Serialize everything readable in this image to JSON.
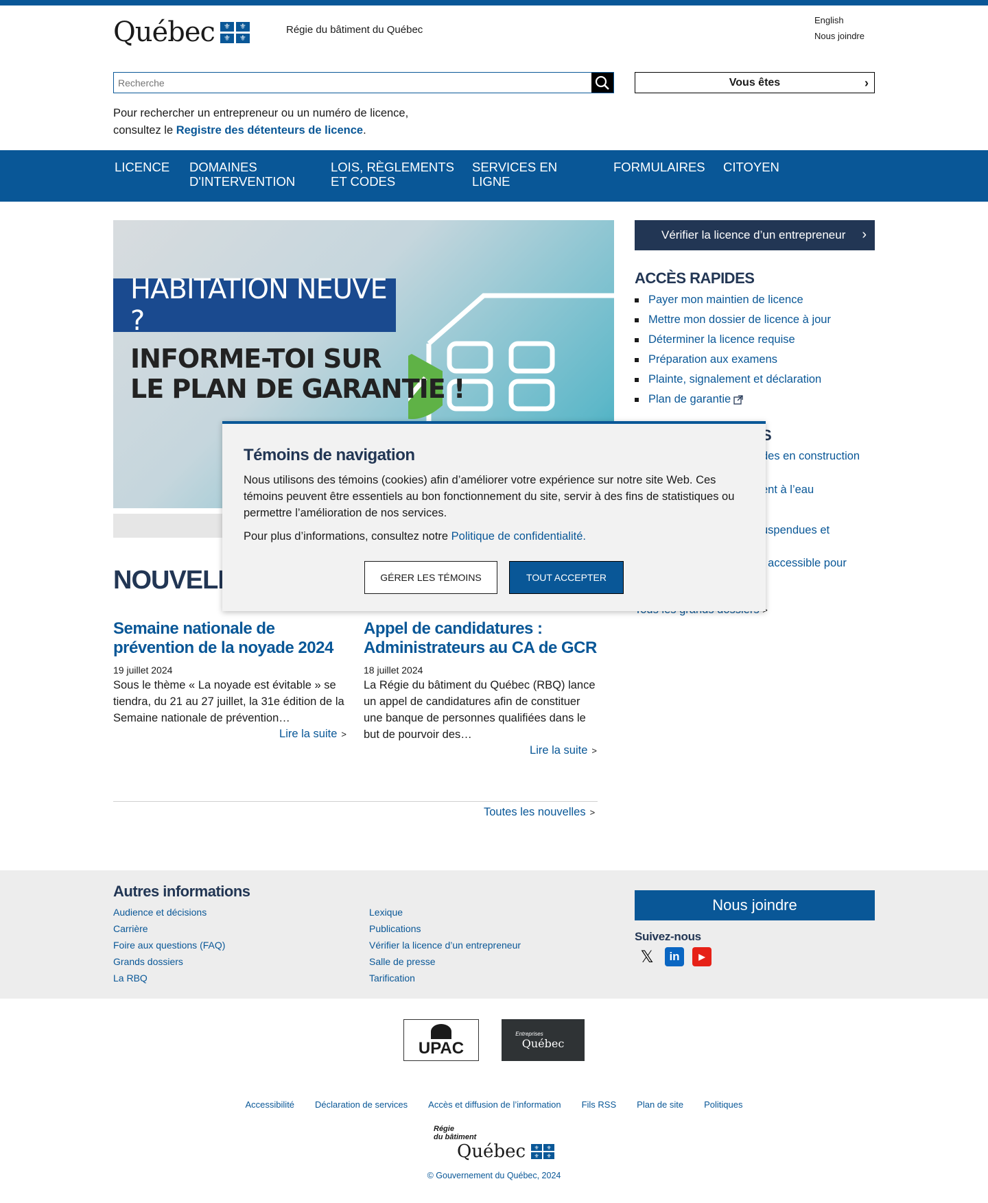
{
  "header": {
    "logo_word": "Québec",
    "org_name": "Régie du bâtiment du Québec",
    "lang_link": "English",
    "contact_link": "Nous joindre",
    "search_placeholder": "Recherche",
    "vous_etes": "Vous êtes",
    "search_note_line1": "Pour rechercher un entrepreneur ou un numéro de licence,",
    "search_note_prefix": "consultez le ",
    "search_note_link": "Registre des détenteurs de licence",
    "search_note_suffix": "."
  },
  "nav": [
    {
      "label": "LICENCE"
    },
    {
      "label": "DOMAINES D'INTERVENTION"
    },
    {
      "label": "LOIS, RÈGLEMENTS ET CODES"
    },
    {
      "label": "SERVICES EN LIGNE"
    },
    {
      "label": "FORMULAIRES"
    },
    {
      "label": "CITOYEN"
    }
  ],
  "hero": {
    "band": "HABITATION NEUVE ?",
    "line1": "INFORME-TOI SUR",
    "line2": "LE PLAN DE GARANTIE !"
  },
  "sidebar": {
    "verify_btn": "Vérifier la licence d’un entrepreneur",
    "quick_title": "ACCÈS RAPIDES",
    "quick_links": [
      "Payer mon maintien de licence",
      "Mettre mon dossier de licence à jour",
      "Déterminer la licence requise",
      "Préparation aux examens",
      "Plainte, signalement et déclaration",
      "Plan de garantie"
    ],
    "partial_title": "S",
    "partial_links": [
      "des en construction",
      "ent à l’eau",
      "uspendues et",
      "t accessible pour"
    ],
    "dossiers_link": "Tous les grands dossiers"
  },
  "news": {
    "title": "NOUVELL",
    "items": [
      {
        "title": "Semaine nationale de prévention de la noyade 2024",
        "date": "19 juillet 2024",
        "summary": "Sous le thème « La noyade est évitable  » se tiendra, du 21 au 27 juillet, la 31e édition de la Semaine nationale de prévention…",
        "more": "Lire la suite"
      },
      {
        "title": "Appel de candidatures : Administrateurs au CA de GCR",
        "date": "18 juillet 2024",
        "summary": "La Régie du bâtiment du Québec (RBQ) lance un appel de candidatures afin de constituer une banque de personnes qualifiées dans le but de pourvoir des…",
        "more": "Lire la suite"
      }
    ],
    "all_news": "Toutes les nouvelles"
  },
  "footer": {
    "title": "Autres informations",
    "col1": [
      "Audience et décisions",
      "Carrière",
      "Foire aux questions (FAQ)",
      "Grands dossiers",
      "La RBQ"
    ],
    "col2": [
      "Lexique",
      "Publications",
      "Vérifier la licence d’un entrepreneur",
      "Salle de presse",
      "Tarification"
    ],
    "contact_btn": "Nous joindre",
    "follow": "Suivez-nous",
    "partner1": "UPAC",
    "partner2_small": "Entreprises",
    "partner2": "Québec",
    "legal": [
      "Accessibilité",
      "Déclaration de services",
      "Accès et diffusion de l’information",
      "Fils RSS",
      "Plan de site",
      "Politiques"
    ],
    "rbq_line1": "Régie",
    "rbq_line2": "du bâtiment",
    "rbq_word": "Québec",
    "copyright": "© Gouvernement du Québec, 2024"
  },
  "cookie": {
    "title": "Témoins de navigation",
    "text": "Nous utilisons des témoins (cookies) afin d’améliorer votre expérience sur notre site Web. Ces témoins peuvent être essentiels au bon fonctionnement du site, servir à des fins de statistiques ou permettre l’amélioration de nos services.",
    "more_prefix": "Pour plus d’informations, consultez notre ",
    "more_link": "Politique de confidentialité.",
    "manage_btn": "GÉRER LES TÉMOINS",
    "accept_btn": "TOUT ACCEPTER"
  }
}
